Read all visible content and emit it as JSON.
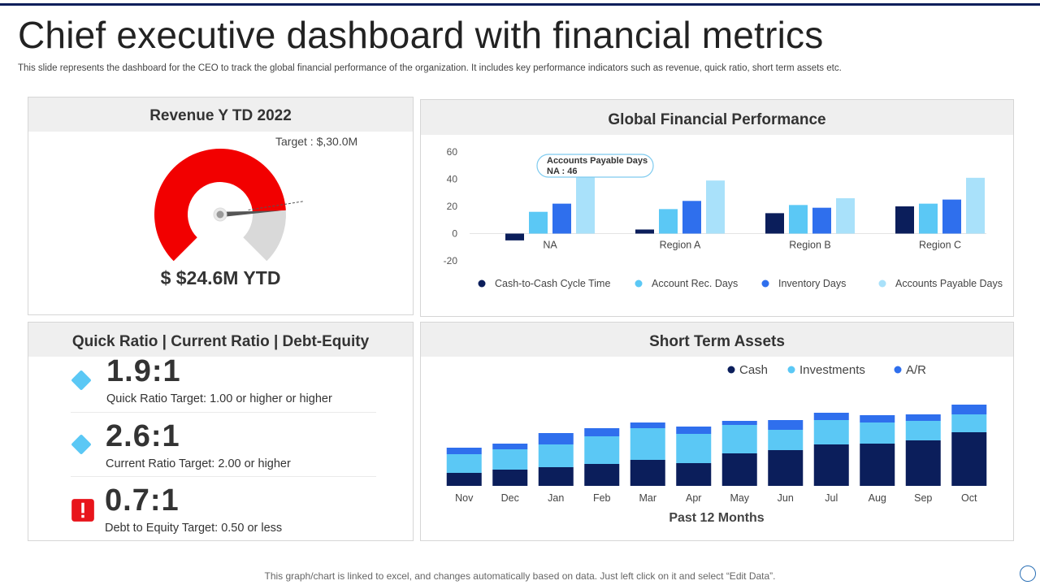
{
  "header": {
    "title": "Chief executive dashboard with financial metrics",
    "subtitle": "This slide represents the dashboard for the CEO to track the global financial performance of the organization. It includes key performance indicators such as revenue, quick ratio, short term assets etc."
  },
  "revenue_panel": {
    "title": "Revenue Y TD 2022",
    "target_label": "Target : $,30.0M",
    "value": "$ $24.6M YTD",
    "colors": {
      "achieved": "#f20000",
      "remaining": "#d9d9d9",
      "needle": "#555555"
    }
  },
  "ratios_panel": {
    "title": "Quick Ratio | Current Ratio | Debt-Equity",
    "items": [
      {
        "value": "1.9:1",
        "label": "Quick Ratio Target: 1.00 or higher or higher",
        "icon": "diamond-icon",
        "color": "#5bc8f5"
      },
      {
        "value": "2.6:1",
        "label": "Current Ratio Target: 2.00 or higher",
        "icon": "diamond-icon",
        "color": "#5bc8f5"
      },
      {
        "value": "0.7:1",
        "label": "Debt to Equity Target: 0.50 or less",
        "icon": "alert-icon",
        "color": "#e8141b"
      }
    ]
  },
  "chart_data": [
    {
      "type": "bar",
      "title": "Global Financial Performance",
      "categories": [
        "NA",
        "Region A",
        "Region B",
        "Region C"
      ],
      "ylim": [
        -20,
        60
      ],
      "yticks": [
        -20,
        0,
        20,
        40,
        60
      ],
      "grid": false,
      "legend_position": "bottom",
      "series": [
        {
          "name": "Cash-to-Cash Cycle Time",
          "color": "#0b1e5b",
          "values": [
            -5,
            3,
            15,
            20
          ]
        },
        {
          "name": "Account Rec. Days",
          "color": "#5bc8f5",
          "values": [
            16,
            18,
            21,
            22
          ]
        },
        {
          "name": "Inventory Days",
          "color": "#2f6fed",
          "values": [
            22,
            24,
            19,
            25
          ]
        },
        {
          "name": "Accounts Payable Days",
          "color": "#a9e1fa",
          "values": [
            46,
            39,
            26,
            41
          ]
        }
      ],
      "callout": {
        "title": "Accounts Payable Days",
        "text": "NA : 46"
      }
    },
    {
      "type": "bar",
      "stacked": true,
      "title": "Short Term Assets",
      "xlabel": "Past 12 Months",
      "categories": [
        "Nov",
        "Dec",
        "Jan",
        "Feb",
        "Mar",
        "Apr",
        "May",
        "Jun",
        "Jul",
        "Aug",
        "Sep",
        "Oct"
      ],
      "legend_position": "top",
      "series": [
        {
          "name": "Cash",
          "color": "#0b1e5b",
          "values": [
            16,
            20,
            23,
            27,
            32,
            28,
            40,
            44,
            51,
            52,
            56,
            66
          ]
        },
        {
          "name": "Investments",
          "color": "#5bc8f5",
          "values": [
            23,
            25,
            28,
            34,
            39,
            36,
            35,
            25,
            30,
            26,
            24,
            22
          ]
        },
        {
          "name": "A/R",
          "color": "#2f6fed",
          "values": [
            8,
            7,
            14,
            10,
            7,
            9,
            5,
            12,
            9,
            9,
            8,
            12
          ]
        }
      ]
    }
  ],
  "footer": {
    "note": "This graph/chart is linked to excel, and changes automatically based on data. Just left click on it and select “Edit Data”."
  }
}
